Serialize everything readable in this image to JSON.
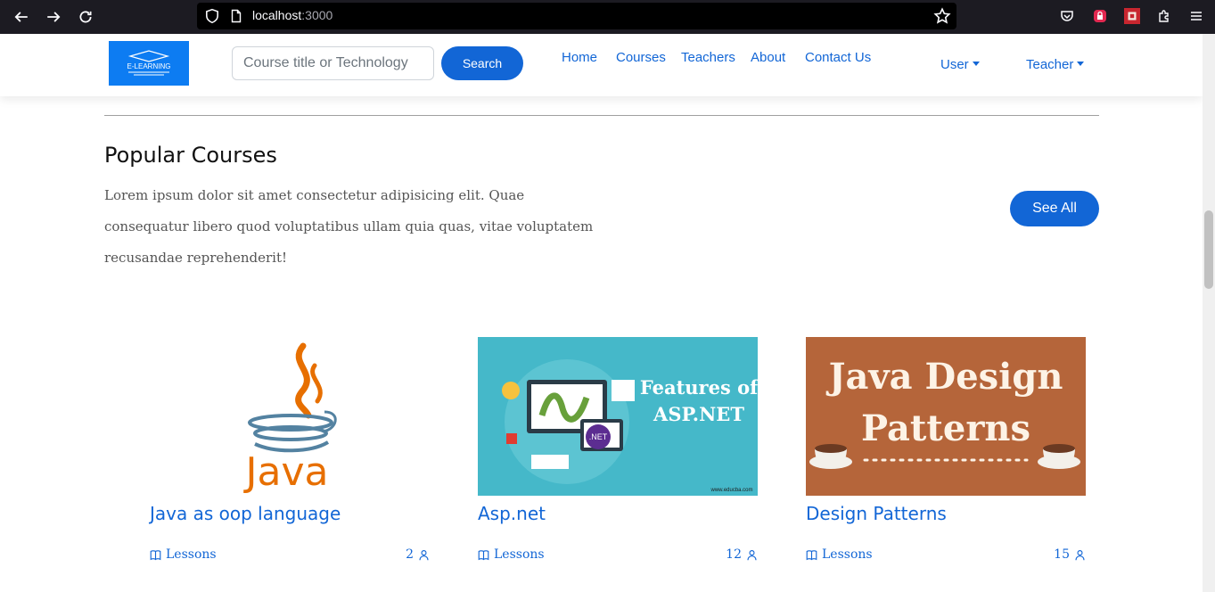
{
  "browser": {
    "url_host": "localhost",
    "url_port": ":3000"
  },
  "navbar": {
    "logo_text": "E-LEARNING",
    "search_placeholder": "Course title or Technology",
    "search_button": "Search",
    "links": [
      "Home",
      "Courses",
      "Teachers",
      "About",
      "Contact Us"
    ],
    "user_dropdown": "User",
    "teacher_dropdown": "Teacher"
  },
  "section": {
    "title": "Popular Courses",
    "description": "Lorem ipsum dolor sit amet consectetur adipisicing elit. Quae consequatur libero quod voluptatibus ullam quia quas, vitae voluptatem recusandae reprehenderit!",
    "see_all": "See All"
  },
  "courses": [
    {
      "title": "Java as oop language",
      "lessons_label": "Lessons",
      "count": "2",
      "image": "java-logo"
    },
    {
      "title": "Asp.net",
      "lessons_label": "Lessons",
      "count": "12",
      "image": "aspnet-banner",
      "banner_line1": "Features of",
      "banner_line2": "ASP.NET",
      "banner_site": "www.educba.com",
      "badge": ".NET"
    },
    {
      "title": "Design Patterns",
      "lessons_label": "Lessons",
      "count": "15",
      "image": "java-design-patterns-banner",
      "banner_line1": "Java Design",
      "banner_line2": "Patterns"
    }
  ],
  "colors": {
    "primary": "#1266d6",
    "chrome_bg": "#1c1b22",
    "asp_bg": "#45b8c9",
    "patterns_bg": "#b5653a"
  }
}
